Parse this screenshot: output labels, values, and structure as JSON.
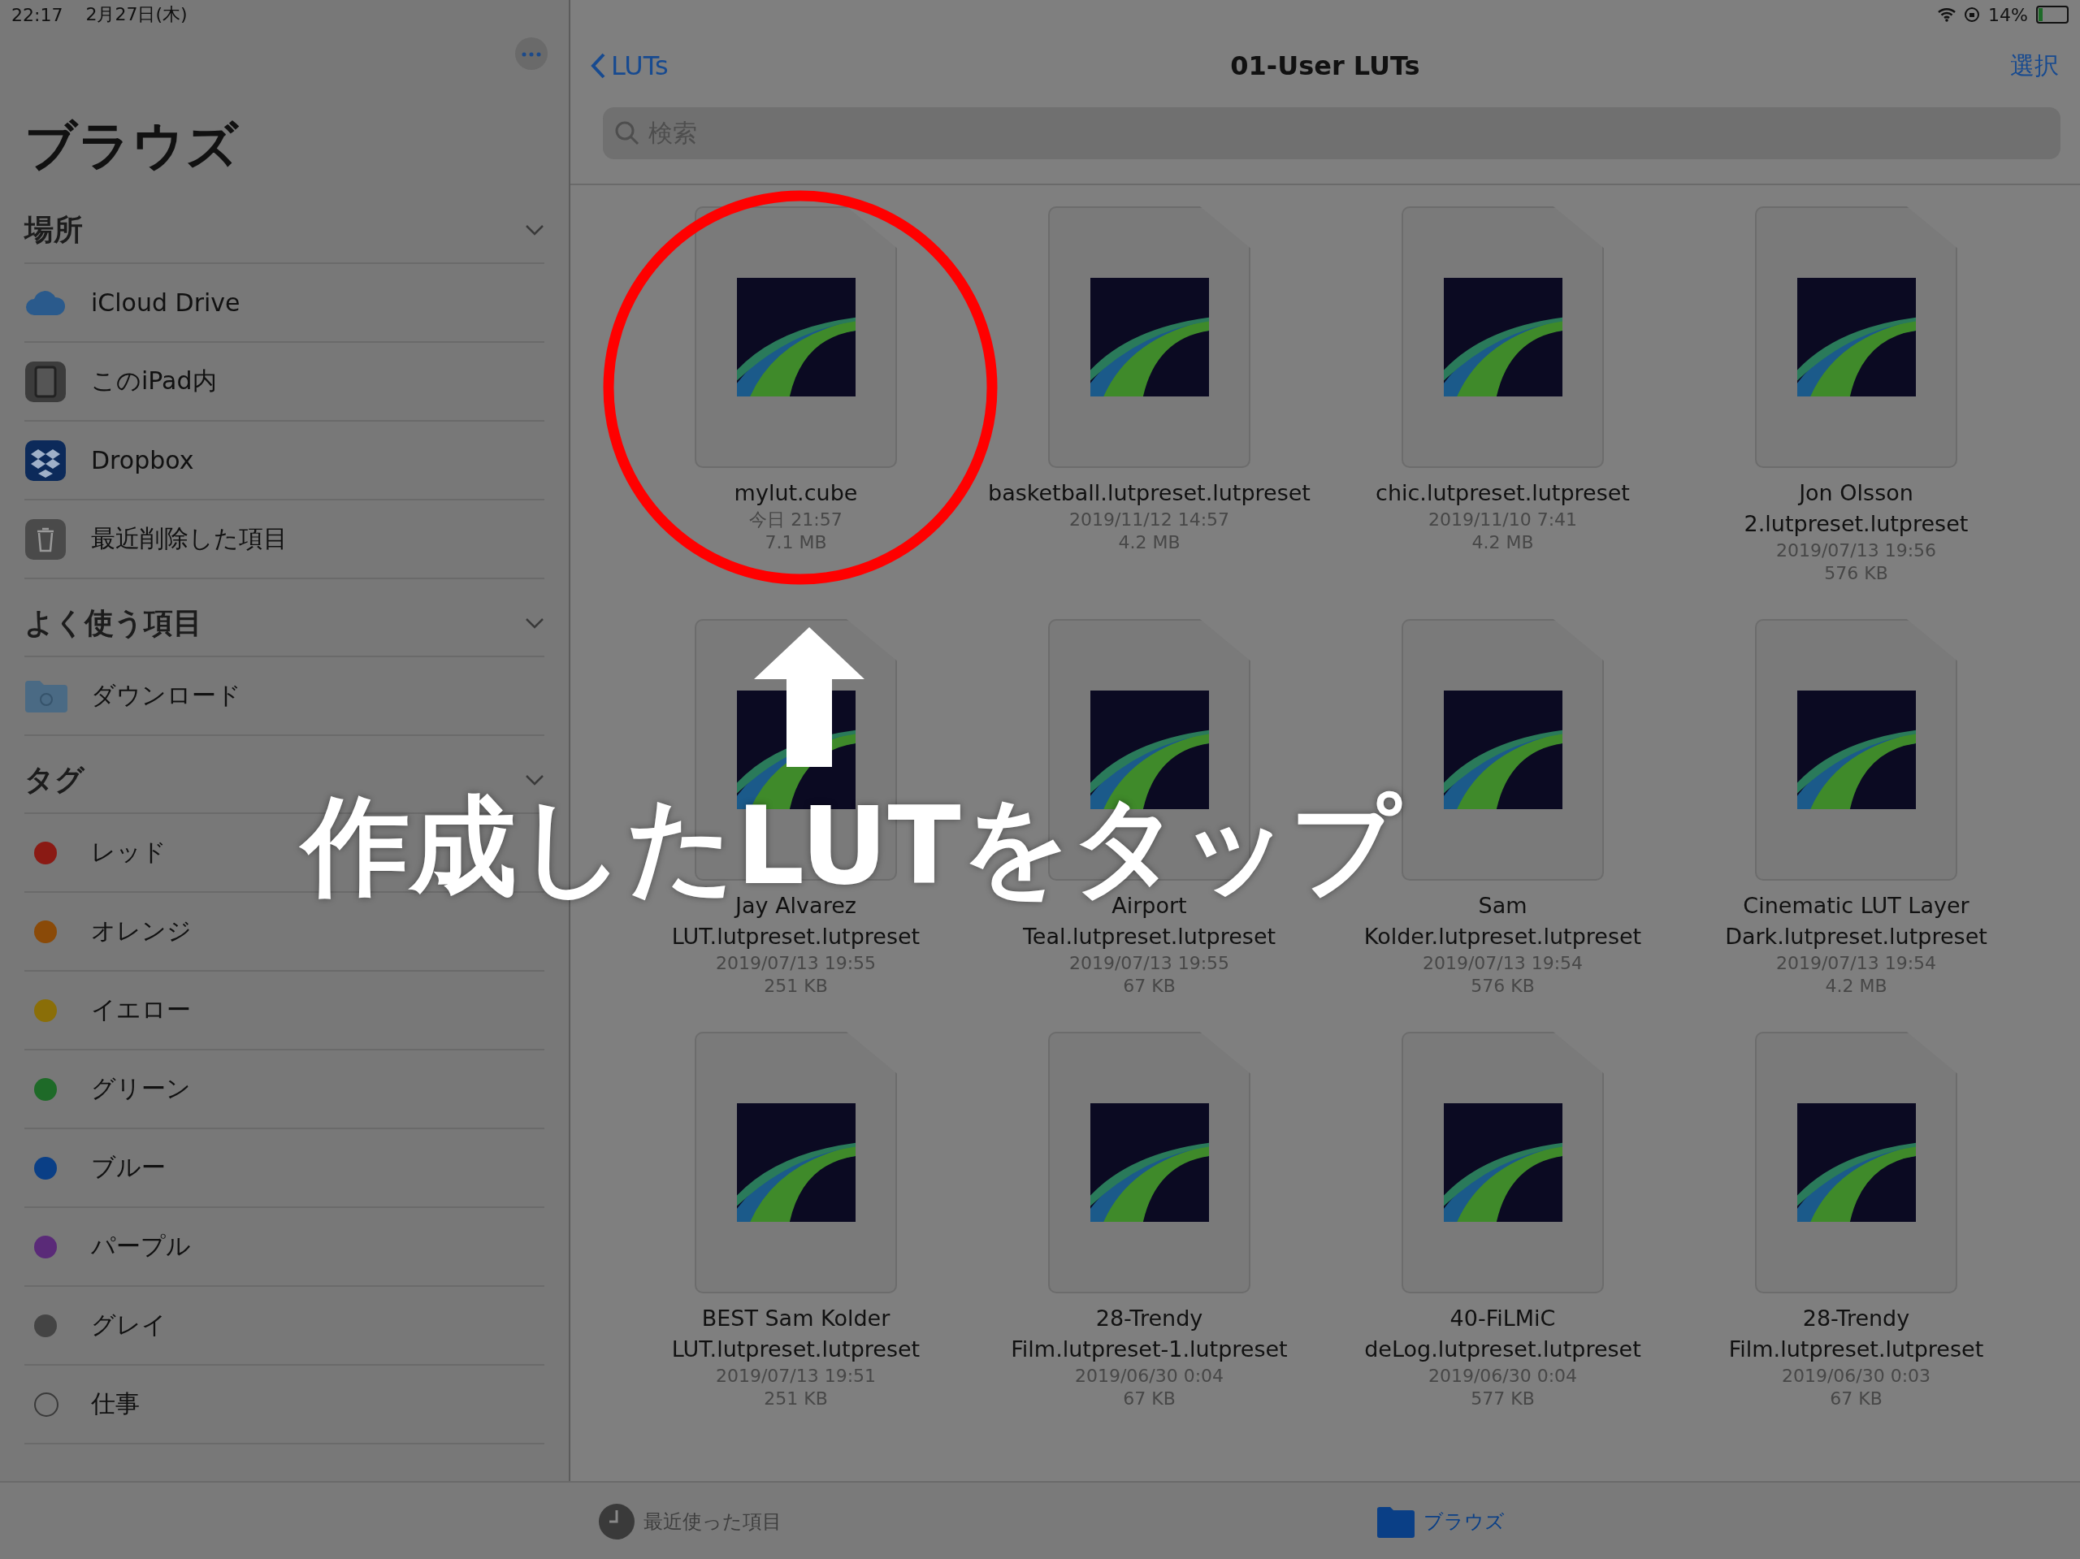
{
  "status_bar": {
    "time": "22:17",
    "date": "2月27日(木)",
    "battery": "14%"
  },
  "sidebar": {
    "title": "ブラウズ",
    "sections": [
      {
        "title": "場所",
        "expanded": true,
        "items": [
          {
            "label": "iCloud Drive",
            "kind": "icloud"
          },
          {
            "label": "このiPad内",
            "kind": "ipad"
          },
          {
            "label": "Dropbox",
            "kind": "dropbox"
          },
          {
            "label": "最近削除した項目",
            "kind": "trash"
          }
        ]
      },
      {
        "title": "よく使う項目",
        "expanded": true,
        "items": [
          {
            "label": "ダウンロード",
            "kind": "folder"
          }
        ]
      },
      {
        "title": "タグ",
        "expanded": true,
        "items": [
          {
            "label": "レッド",
            "kind": "tag",
            "color": "#8a1a14"
          },
          {
            "label": "オレンジ",
            "kind": "tag",
            "color": "#8a4a08"
          },
          {
            "label": "イエロー",
            "kind": "tag",
            "color": "#8a6e08"
          },
          {
            "label": "グリーン",
            "kind": "tag",
            "color": "#1e6a28"
          },
          {
            "label": "ブルー",
            "kind": "tag",
            "color": "#0a3f86"
          },
          {
            "label": "パープル",
            "kind": "tag",
            "color": "#5a2a78"
          },
          {
            "label": "グレイ",
            "kind": "tag",
            "color": "#444444"
          },
          {
            "label": "仕事",
            "kind": "ring"
          }
        ]
      }
    ]
  },
  "nav": {
    "back": "LUTs",
    "title": "01-User LUTs",
    "action": "選択",
    "search_placeholder": "検索"
  },
  "files": [
    {
      "name_lines": [
        "mylut.cube"
      ],
      "date": "今日 21:57",
      "size": "7.1 MB"
    },
    {
      "name_lines": [
        "basketball.lutpreset.lutpreset"
      ],
      "date": "2019/11/12 14:57",
      "size": "4.2 MB"
    },
    {
      "name_lines": [
        "chic.lutpreset.lutpreset"
      ],
      "date": "2019/11/10 7:41",
      "size": "4.2 MB"
    },
    {
      "name_lines": [
        "Jon Olsson",
        "2.lutpreset.lutpreset"
      ],
      "date": "2019/07/13 19:56",
      "size": "576 KB"
    },
    {
      "name_lines": [
        "Jay Alvarez",
        "LUT.lutpreset.lutpreset"
      ],
      "date": "2019/07/13 19:55",
      "size": "251 KB"
    },
    {
      "name_lines": [
        "Airport",
        "Teal.lutpreset.lutpreset"
      ],
      "date": "2019/07/13 19:55",
      "size": "67 KB"
    },
    {
      "name_lines": [
        "Sam",
        "Kolder.lutpreset.lutpreset"
      ],
      "date": "2019/07/13 19:54",
      "size": "576 KB"
    },
    {
      "name_lines": [
        "Cinematic LUT Layer",
        "Dark.lutpreset.lutpreset"
      ],
      "date": "2019/07/13 19:54",
      "size": "4.2 MB"
    },
    {
      "name_lines": [
        "BEST Sam Kolder",
        "LUT.lutpreset.lutpreset"
      ],
      "date": "2019/07/13 19:51",
      "size": "251 KB"
    },
    {
      "name_lines": [
        "28-Trendy",
        "Film.lutpreset-1.lutpreset"
      ],
      "date": "2019/06/30 0:04",
      "size": "67 KB"
    },
    {
      "name_lines": [
        "40-FiLMiC",
        "deLog.lutpreset.lutpreset"
      ],
      "date": "2019/06/30 0:04",
      "size": "577 KB"
    },
    {
      "name_lines": [
        "28-Trendy",
        "Film.lutpreset.lutpreset"
      ],
      "date": "2019/06/30 0:03",
      "size": "67 KB"
    }
  ],
  "tab_bar": [
    {
      "label": "最近使った項目",
      "kind": "recent",
      "selected": false
    },
    {
      "label": "ブラウズ",
      "kind": "browse",
      "selected": true
    }
  ],
  "annotation": {
    "caption": "作成したLUTをタップ"
  }
}
